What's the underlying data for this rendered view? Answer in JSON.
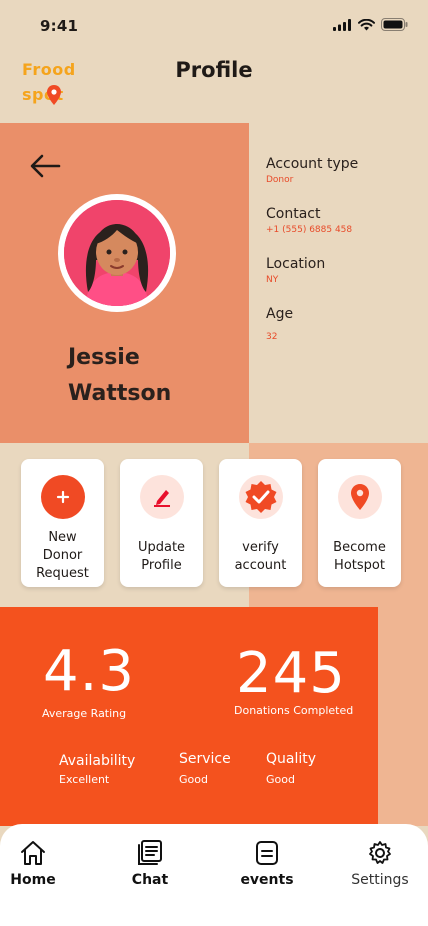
{
  "status_bar": {
    "time": "9:41"
  },
  "header": {
    "logo_line1": "Frood",
    "logo_line2": "spot",
    "title": "Profile"
  },
  "profile": {
    "name_first": "Jessie",
    "name_last": "Wattson",
    "info": [
      {
        "label": "Account type",
        "value": "Donor"
      },
      {
        "label": "Contact",
        "value": "+1 (555) 6885 458"
      },
      {
        "label": "Location",
        "value": "NY"
      },
      {
        "label": "Age",
        "value": "32"
      }
    ]
  },
  "actions": [
    {
      "line1": "New",
      "line2": "Donor",
      "line3": "Request",
      "icon": "plus-icon"
    },
    {
      "line1": "Update",
      "line2": "Profile",
      "icon": "edit-icon"
    },
    {
      "line1": "verify",
      "line2": "account",
      "icon": "verified-badge-icon"
    },
    {
      "line1": "Become",
      "line2": "Hotspot",
      "icon": "location-pin-icon"
    }
  ],
  "stats": {
    "rating": "4.3",
    "rating_label": "Average Rating",
    "donations": "245",
    "donations_label": "Donations Completed",
    "metrics": [
      {
        "label": "Availability",
        "value": "Excellent"
      },
      {
        "label": "Service",
        "value": "Good"
      },
      {
        "label": "Quality",
        "value": "Good"
      }
    ]
  },
  "nav": [
    {
      "label": "Home",
      "icon": "home-icon"
    },
    {
      "label": "Chat",
      "icon": "chat-icon"
    },
    {
      "label": "events",
      "icon": "events-icon"
    },
    {
      "label": "Settings",
      "icon": "gear-icon"
    }
  ],
  "colors": {
    "accent": "#f4521e",
    "profile_bg": "#ea8f69",
    "page_bg": "#e9d8bf",
    "logo": "#f5a41c"
  }
}
